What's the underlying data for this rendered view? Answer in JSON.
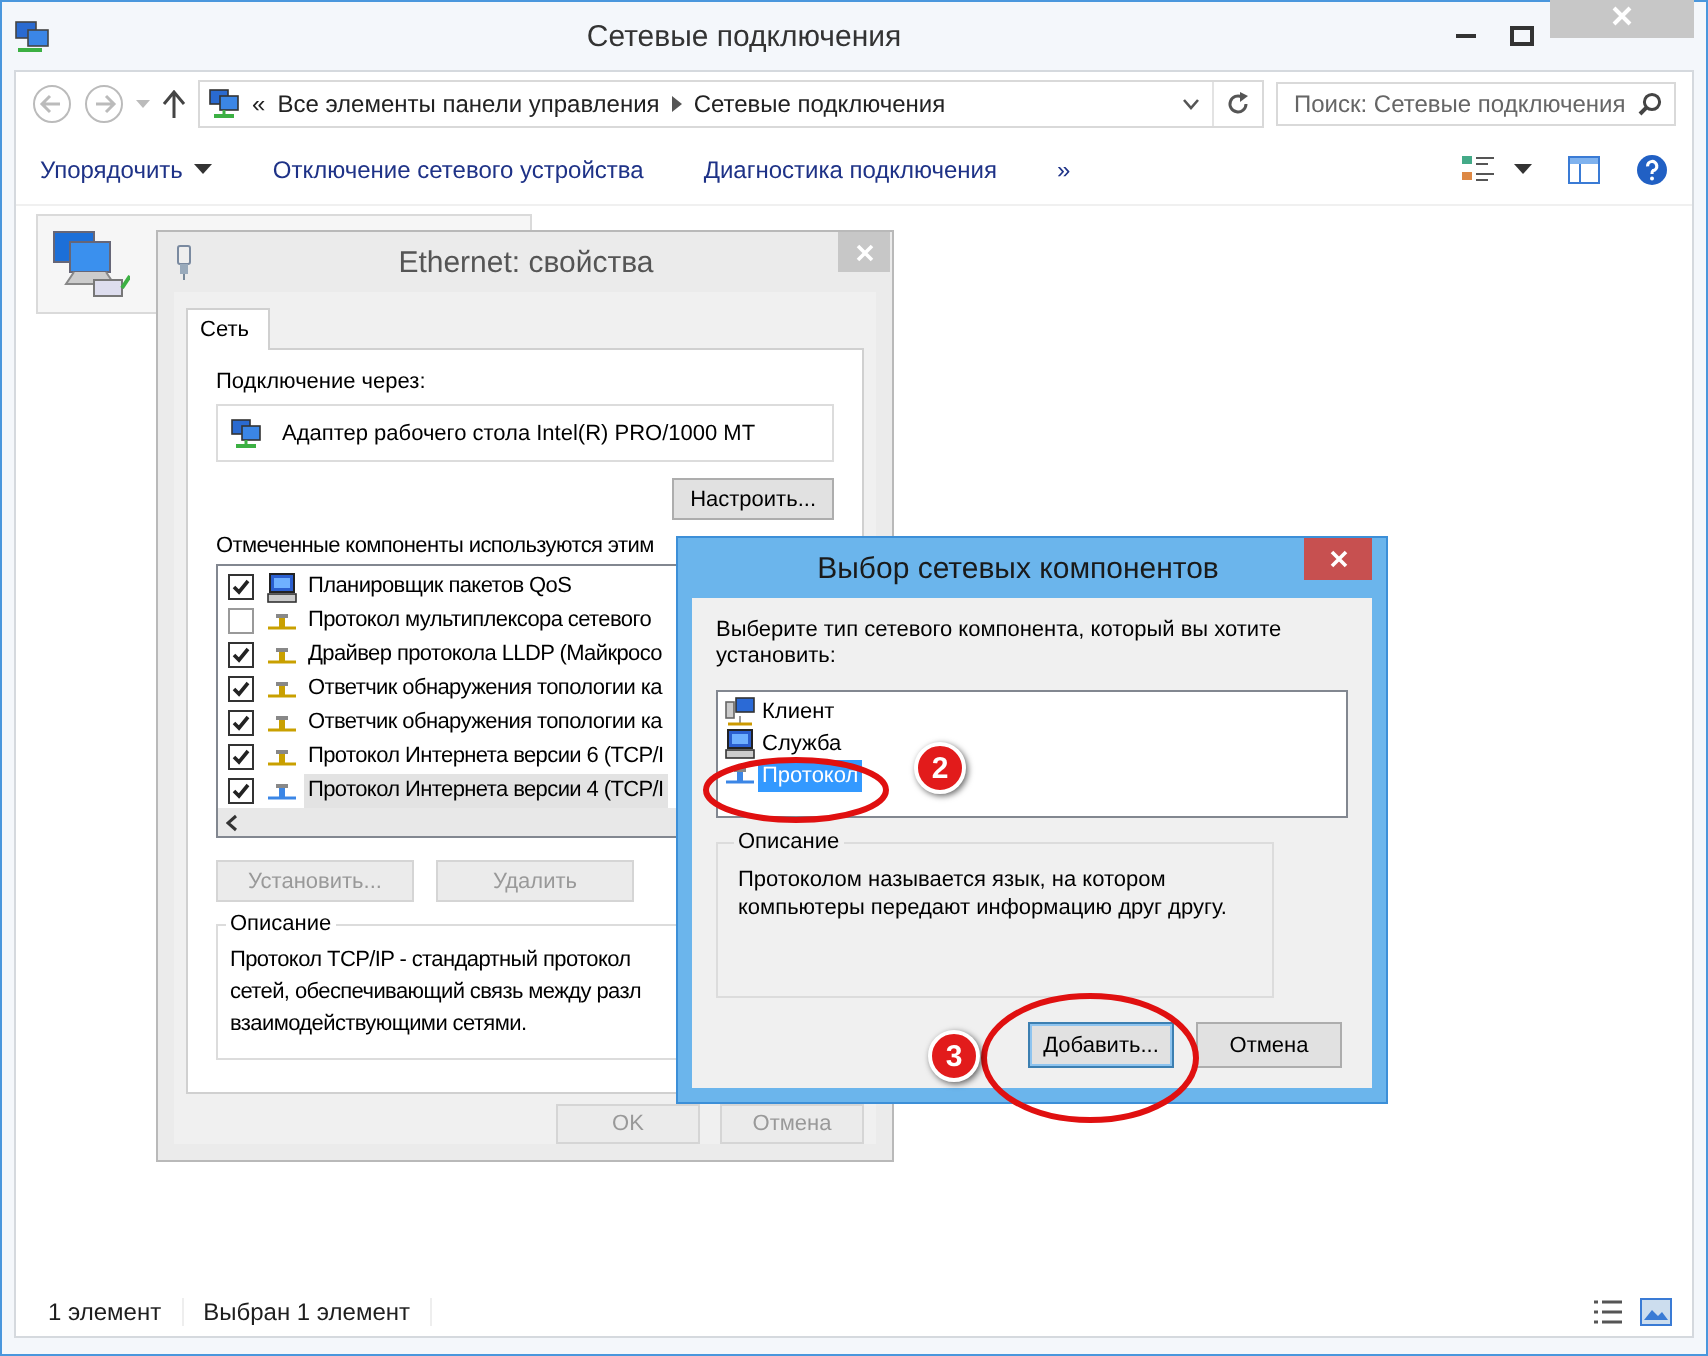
{
  "window": {
    "title": "Сетевые подключения"
  },
  "address_bar": {
    "overflow": "«",
    "path": [
      {
        "label": "Все элементы панели управления"
      },
      {
        "label": "Сетевые подключения"
      }
    ]
  },
  "search": {
    "placeholder": "Поиск: Сетевые подключения"
  },
  "toolbar": {
    "items": [
      {
        "label": "Упорядочить",
        "dropdown": true
      },
      {
        "label": "Отключение сетевого устройства",
        "dropdown": false
      },
      {
        "label": "Диагностика подключения",
        "dropdown": false
      }
    ],
    "more": "»"
  },
  "connections": [
    {
      "selected": true
    }
  ],
  "properties_dialog": {
    "title": "Ethernet: свойства",
    "active": false,
    "tabs": [
      {
        "label": "Сеть",
        "selected": true
      }
    ],
    "connect_using_label": "Подключение через:",
    "adapter": "Адаптер рабочего стола Intel(R) PRO/1000 MT",
    "configure_button": "Настроить...",
    "components_label": "Отмеченные компоненты используются этим",
    "components": [
      {
        "label": "Планировщик пакетов QoS",
        "kind": "service",
        "checked": true,
        "selected": false
      },
      {
        "label": "Протокол мультиплексора сетевого",
        "kind": "protocol",
        "checked": false,
        "selected": false
      },
      {
        "label": "Драйвер протокола LLDP (Майкросо",
        "kind": "protocol",
        "checked": true,
        "selected": false
      },
      {
        "label": "Ответчик обнаружения топологии ка",
        "kind": "protocol",
        "checked": true,
        "selected": false
      },
      {
        "label": "Ответчик обнаружения топологии ка",
        "kind": "protocol",
        "checked": true,
        "selected": false
      },
      {
        "label": "Протокол Интернета версии 6 (TCP/I",
        "kind": "protocol",
        "checked": true,
        "selected": false
      },
      {
        "label": "Протокол Интернета версии 4 (TCP/I",
        "kind": "protocol-blue",
        "checked": true,
        "selected": true
      }
    ],
    "buttons": [
      {
        "label": "Установить...",
        "disabled": true
      },
      {
        "label": "Удалить",
        "disabled": true
      }
    ],
    "description": {
      "legend": "Описание",
      "lines": [
        "Протокол TCP/IP - стандартный протокол",
        "сетей, обеспечивающий связь между разл",
        "взаимодействующими сетями."
      ]
    },
    "footer_buttons": [
      {
        "label": "OK",
        "disabled": true
      },
      {
        "label": "Отмена",
        "disabled": true
      }
    ]
  },
  "select_dialog": {
    "title": "Выбор сетевых компонентов",
    "active": true,
    "prompt": "Выберите тип сетевого компонента, который вы хотите установить:",
    "types": [
      {
        "label": "Клиент",
        "kind": "client",
        "selected": false
      },
      {
        "label": "Служба",
        "kind": "service",
        "selected": false
      },
      {
        "label": "Протокол",
        "kind": "protocol",
        "selected": true
      }
    ],
    "description": {
      "legend": "Описание",
      "text": "Протоколом называется язык, на котором компьютеры передают информацию друг другу."
    },
    "buttons": [
      {
        "label": "Добавить...",
        "default": true
      },
      {
        "label": "Отмена",
        "default": false
      }
    ]
  },
  "annotations": [
    {
      "number": "2"
    },
    {
      "number": "3"
    }
  ],
  "status_bar": {
    "items": [
      "1 элемент",
      "Выбран 1 элемент"
    ]
  }
}
